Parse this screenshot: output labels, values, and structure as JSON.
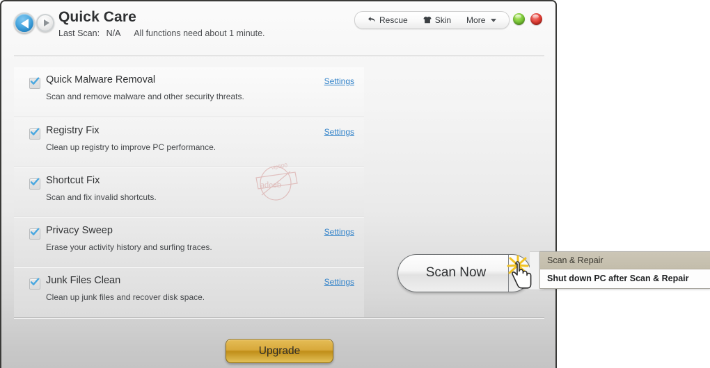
{
  "window": {
    "title": "Quick Care",
    "last_scan_label": "Last Scan:",
    "last_scan_value": "N/A",
    "hint": "All functions need about 1 minute.",
    "nav": {
      "back_icon": "arrow-left-icon",
      "forward_icon": "arrow-right-icon"
    },
    "controls": {
      "minimize_icon": "minimize-orb-icon",
      "close_icon": "close-orb-icon",
      "minimize_color": "#7cc93a",
      "close_color": "#e23f36"
    }
  },
  "toolbar": {
    "items": [
      {
        "label": "Rescue",
        "icon": "back-arrow-icon",
        "glyph": "↶"
      },
      {
        "label": "Skin",
        "icon": "tshirt-icon",
        "glyph": "♟"
      },
      {
        "label": "More",
        "icon": "chevron-down-icon",
        "glyph": ""
      }
    ]
  },
  "tasks": [
    {
      "title": "Quick Malware Removal",
      "description": "Scan and remove malware and other security threats.",
      "checked": true,
      "settings_label": "Settings",
      "has_settings": true
    },
    {
      "title": "Registry Fix",
      "description": "Clean up registry to improve PC performance.",
      "checked": true,
      "settings_label": "Settings",
      "has_settings": true
    },
    {
      "title": "Shortcut Fix",
      "description": "Scan and fix invalid shortcuts.",
      "checked": true,
      "settings_label": "",
      "has_settings": false
    },
    {
      "title": "Privacy Sweep",
      "description": "Erase your activity history and surfing traces.",
      "checked": true,
      "settings_label": "Settings",
      "has_settings": true
    },
    {
      "title": "Junk Files Clean",
      "description": "Clean up junk files and recover disk space.",
      "checked": true,
      "settings_label": "Settings",
      "has_settings": true
    }
  ],
  "scan": {
    "button_label": "Scan Now",
    "menu": {
      "items": [
        {
          "label": "Scan & Repair",
          "selected": true
        },
        {
          "label": "Shut down PC after Scan & Repair",
          "selected": false
        }
      ],
      "highlight_color": "#c7c1b1"
    }
  },
  "footer": {
    "upgrade_label": "Upgrade",
    "upgrade_color": "#d8a93b"
  },
  "watermark": {
    "text_main": "adeeb",
    "text_top": "vip600"
  },
  "cursor": {
    "icon": "pointing-hand-click-icon",
    "click_effect_color": "#f2c222"
  },
  "accent": {
    "link_color": "#2f81c9",
    "check_color": "#4aa8e0"
  }
}
